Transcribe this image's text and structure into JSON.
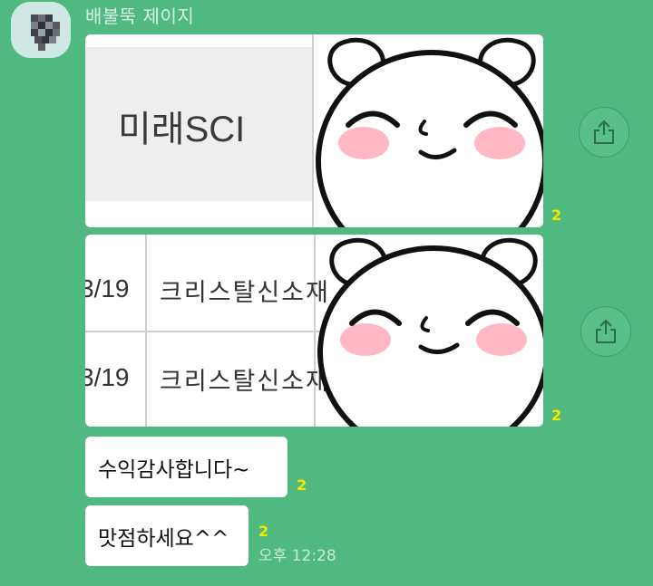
{
  "chat": {
    "sender_name": "배불뚝 제이지",
    "time": "오후 12:28",
    "messages": [
      {
        "type": "image",
        "read_count": "2",
        "image_text": "미래SCI"
      },
      {
        "type": "image",
        "read_count": "2",
        "rows": [
          {
            "date": "3/19",
            "name": "크리스탈신소재"
          },
          {
            "date": "3/19",
            "name": "크리스탈신소재"
          }
        ]
      },
      {
        "type": "text",
        "text": "수익감사합니다~",
        "read_count": "2"
      },
      {
        "type": "text",
        "text": "맛점하세요^^",
        "read_count": "2"
      }
    ]
  },
  "icons": {
    "avatar": "avatar-icon",
    "share": "share-icon"
  },
  "colors": {
    "background": "#4fb97f",
    "read_count": "#f7e600",
    "bubble": "#ffffff"
  }
}
